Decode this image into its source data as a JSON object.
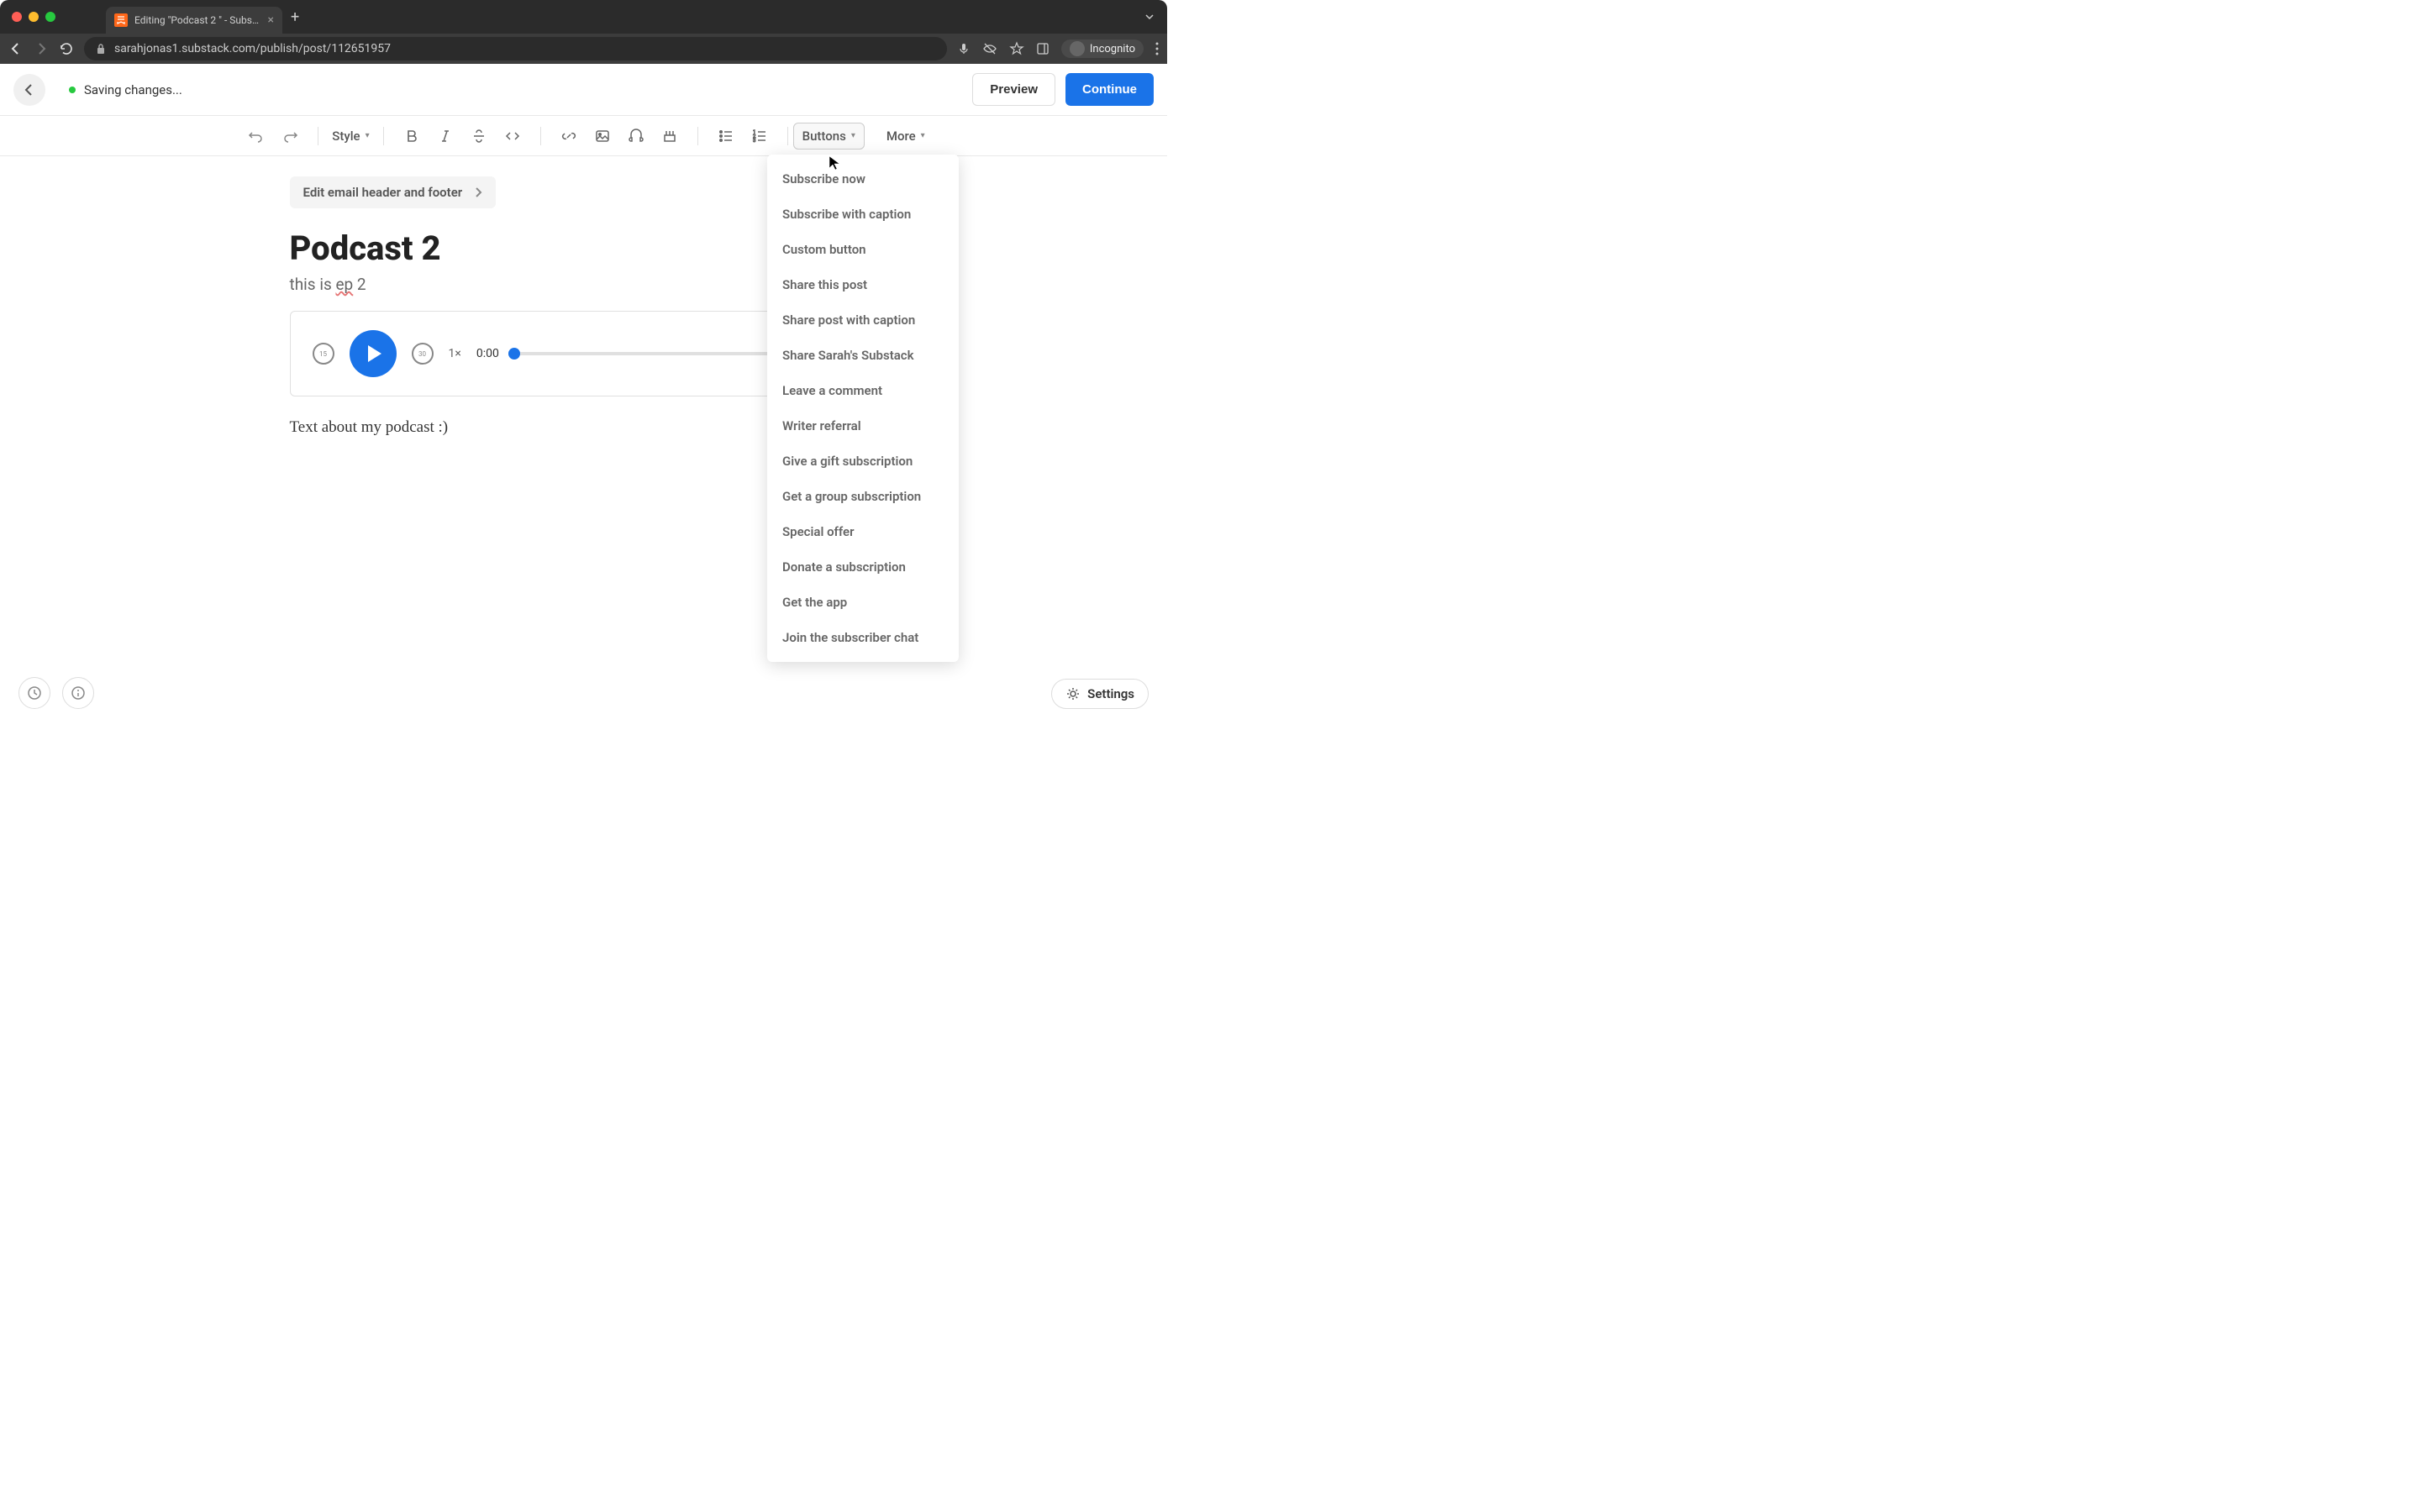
{
  "browser": {
    "tab_title": "Editing \"Podcast 2 \" - Substac",
    "url": "sarahjonas1.substack.com/publish/post/112651957",
    "incognito_label": "Incognito"
  },
  "header": {
    "save_status": "Saving changes...",
    "preview_label": "Preview",
    "continue_label": "Continue"
  },
  "toolbar": {
    "style_label": "Style",
    "buttons_label": "Buttons",
    "more_label": "More"
  },
  "content": {
    "email_header_btn": "Edit email header and footer",
    "post_title": "Podcast 2",
    "subtitle_prefix": "this is ",
    "subtitle_word": "ep",
    "subtitle_suffix": " 2",
    "body_text": "Text about my podcast :)"
  },
  "audio": {
    "skip_back": "15",
    "skip_fwd": "30",
    "speed": "1×",
    "time": "0:00"
  },
  "buttons_menu": [
    "Subscribe now",
    "Subscribe with caption",
    "Custom button",
    "Share this post",
    "Share post with caption",
    "Share Sarah's Substack",
    "Leave a comment",
    "Writer referral",
    "Give a gift subscription",
    "Get a group subscription",
    "Special offer",
    "Donate a subscription",
    "Get the app",
    "Join the subscriber chat"
  ],
  "footer": {
    "settings_label": "Settings"
  }
}
